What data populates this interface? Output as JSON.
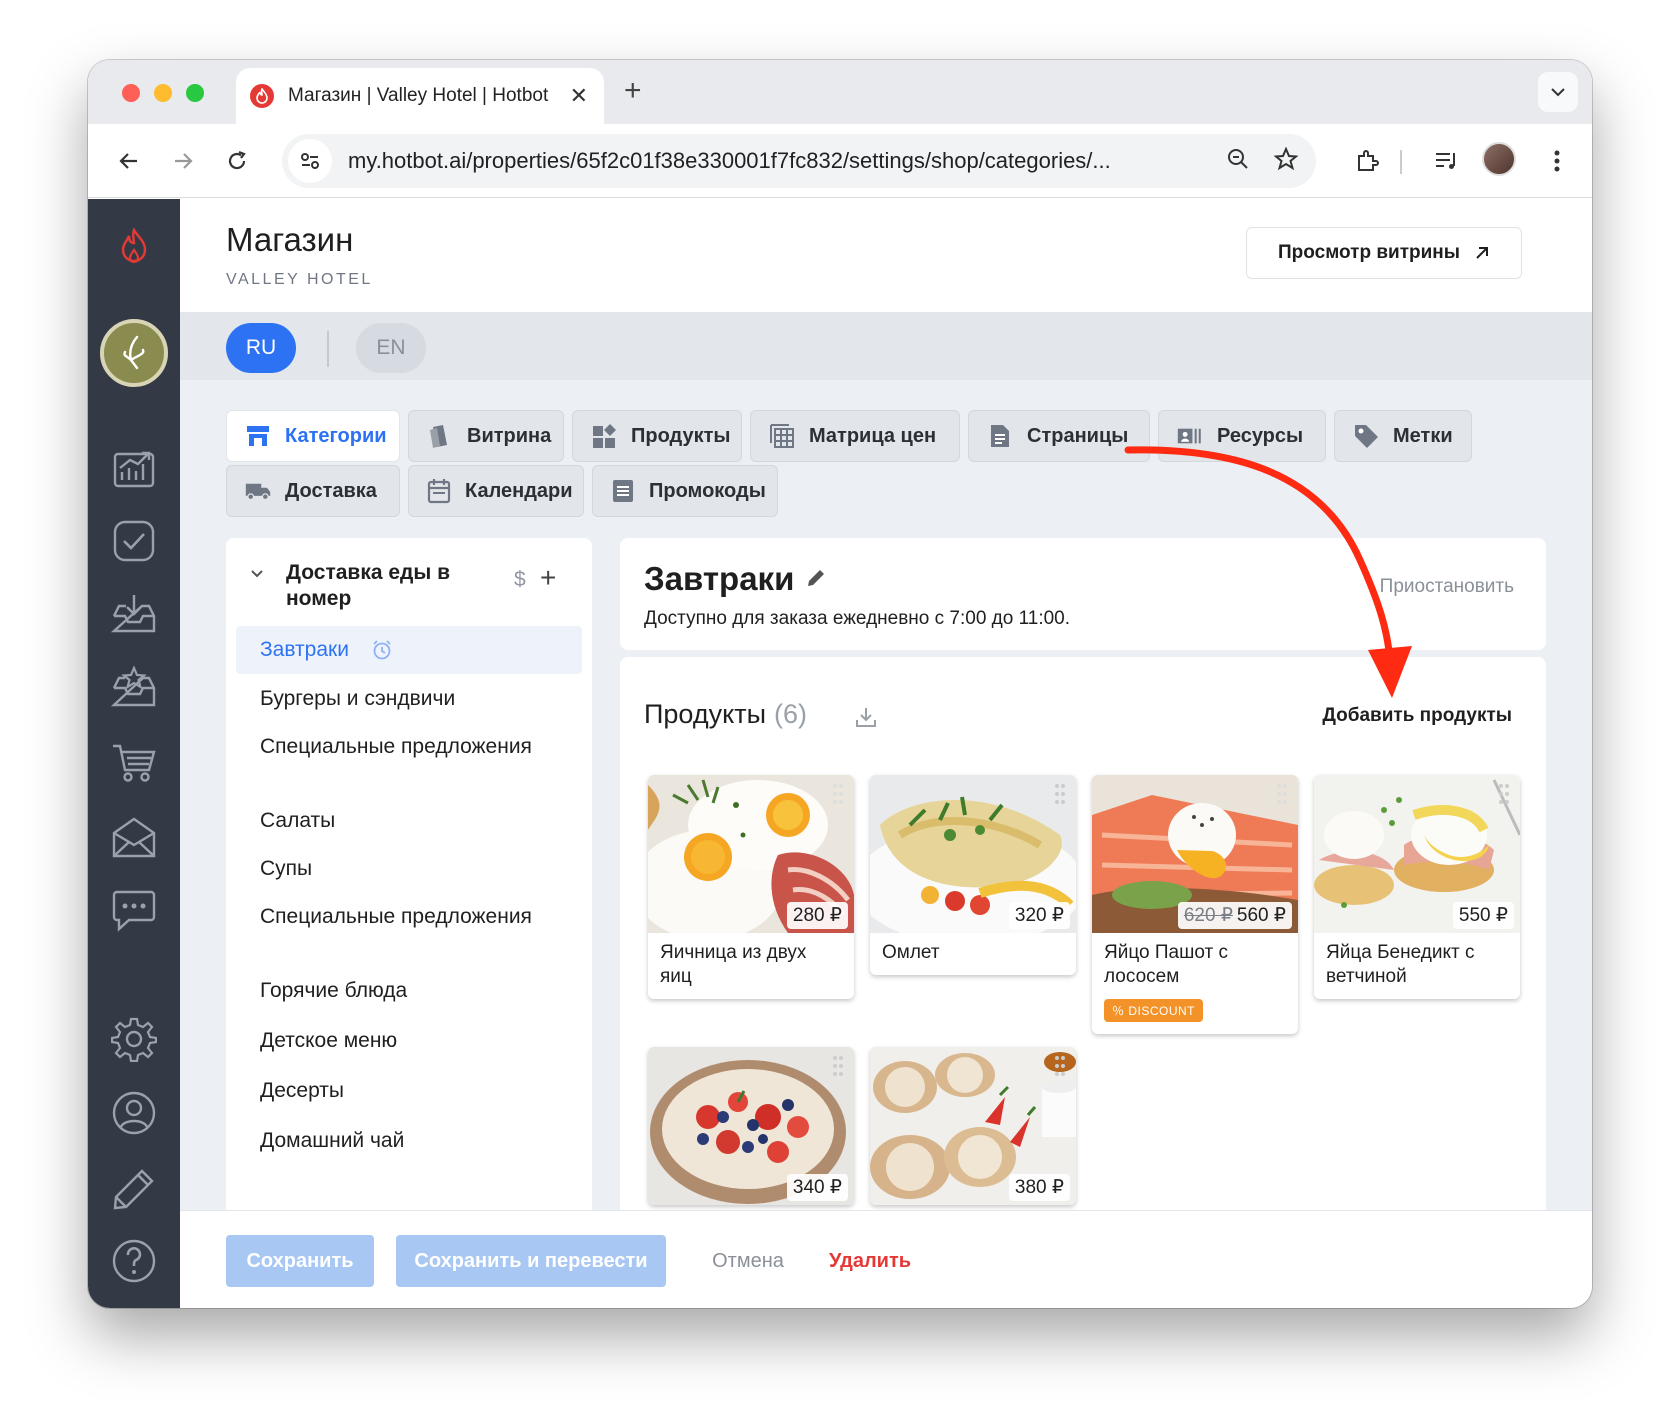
{
  "browser": {
    "tab_title": "Магазин | Valley Hotel | Hotbot",
    "url": "my.hotbot.ai/properties/65f2c01f38e330001f7fc832/settings/shop/categories/..."
  },
  "header": {
    "title": "Магазин",
    "subtitle": "VALLEY HOTEL",
    "preview_button": "Просмотр витрины"
  },
  "languages": {
    "active": "RU",
    "other": "EN"
  },
  "section_tabs": [
    {
      "label": "Категории",
      "icon": "storefront-icon",
      "active": true
    },
    {
      "label": "Витрина",
      "icon": "cards-icon"
    },
    {
      "label": "Продукты",
      "icon": "products-icon"
    },
    {
      "label": "Матрица цен",
      "icon": "price-matrix-icon"
    },
    {
      "label": "Страницы",
      "icon": "page-icon"
    },
    {
      "label": "Ресурсы",
      "icon": "resources-icon"
    },
    {
      "label": "Метки",
      "icon": "tag-icon"
    },
    {
      "label": "Доставка",
      "icon": "truck-icon"
    },
    {
      "label": "Календари",
      "icon": "calendar-icon"
    },
    {
      "label": "Промокоды",
      "icon": "promo-icon"
    }
  ],
  "categories": {
    "group_title": "Доставка еды в номер",
    "group_currency": "$",
    "items": [
      {
        "label": "Завтраки",
        "active": true,
        "schedule_icon": "alarm-clock-icon"
      },
      {
        "label": "Бургеры и сэндвичи"
      },
      {
        "label": "Специальные предложения"
      },
      {
        "label": "Салаты"
      },
      {
        "label": "Супы"
      },
      {
        "label": "Специальные предложения"
      },
      {
        "label": "Горячие блюда"
      },
      {
        "label": "Детское меню"
      },
      {
        "label": "Десерты"
      },
      {
        "label": "Домашний чай"
      }
    ]
  },
  "category_detail": {
    "name": "Завтраки",
    "availability": "Доступно для заказа ежедневно с 7:00 до 11:00.",
    "suspend_label": "Приостановить"
  },
  "products": {
    "title": "Продукты",
    "count": "(6)",
    "add_label": "Добавить продукты",
    "items": [
      {
        "name": "Яичница из двух яиц",
        "price": "280 ₽",
        "old_price": ""
      },
      {
        "name": "Омлет",
        "price": "320 ₽",
        "old_price": ""
      },
      {
        "name": "Яйцо Пашот с лососем",
        "price": "560 ₽",
        "old_price": "620 ₽",
        "badge": "DISCOUNT"
      },
      {
        "name": "Яйца Бенедикт с ветчиной",
        "price": "550 ₽",
        "old_price": ""
      },
      {
        "name": "",
        "price": "340 ₽",
        "old_price": ""
      },
      {
        "name": "",
        "price": "380 ₽",
        "old_price": ""
      }
    ]
  },
  "footer": {
    "save": "Сохранить",
    "save_translate": "Сохранить и перевести",
    "cancel": "Отмена",
    "delete": "Удалить"
  },
  "colors": {
    "accent": "#2d72f2",
    "sidebar": "#343a45",
    "delete": "#e53935",
    "discount": "#f39229",
    "annotation_arrow": "#ff2a12"
  }
}
